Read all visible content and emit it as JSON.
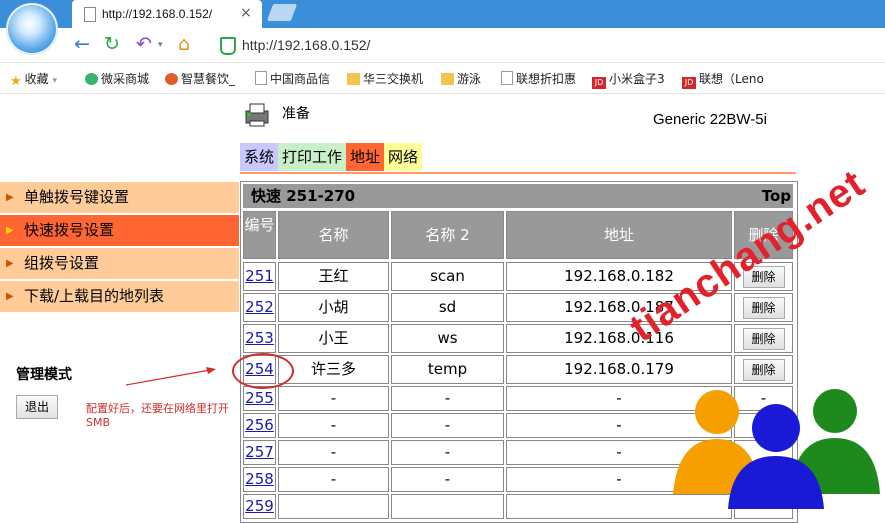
{
  "browser": {
    "tab_title": "http://192.168.0.152/",
    "address": "http://192.168.0.152/",
    "close_glyph": "×",
    "bookmarks": [
      {
        "label": "收藏",
        "icon": "star-icon"
      },
      {
        "label": "微采商城",
        "icon": "store-icon"
      },
      {
        "label": "智慧餐饮_",
        "icon": "food-icon"
      },
      {
        "label": "中国商品信",
        "icon": "page-icon"
      },
      {
        "label": "华三交换机",
        "icon": "folder-icon"
      },
      {
        "label": "游泳",
        "icon": "folder-icon"
      },
      {
        "label": "联想折扣惠",
        "icon": "page-icon"
      },
      {
        "label": "小米盒子3",
        "icon": "jd-icon"
      },
      {
        "label": "联想（Leno",
        "icon": "jd-icon"
      }
    ],
    "jd_badge": "JD"
  },
  "printer": {
    "status": "准备",
    "model": "Generic 22BW-5i"
  },
  "tabs": {
    "system": "系统",
    "print_job": "打印工作",
    "address": "地址",
    "network": "网络"
  },
  "sidebar": {
    "items": [
      {
        "label": "单触拨号键设置",
        "active": false
      },
      {
        "label": "快速拨号设置",
        "active": true
      },
      {
        "label": "组拨号设置",
        "active": false
      },
      {
        "label": "下载/上载目的地列表",
        "active": false
      }
    ],
    "mgmt_label": "管理模式",
    "logout": "退出"
  },
  "annotation": {
    "text": "配置好后，还要在网络里打开SMB"
  },
  "table": {
    "title": "快速 251-270",
    "top_link": "Top",
    "headers": {
      "num": "编号",
      "name": "名称",
      "name2": "名称 2",
      "address": "地址",
      "delete": "删除"
    },
    "rows": [
      {
        "num": "251",
        "name": "王红",
        "name2": "scan",
        "address": "192.168.0.182",
        "delete": "删除"
      },
      {
        "num": "252",
        "name": "小胡",
        "name2": "sd",
        "address": "192.168.0.187",
        "delete": "删除"
      },
      {
        "num": "253",
        "name": "小王",
        "name2": "ws",
        "address": "192.168.0.116",
        "delete": "删除"
      },
      {
        "num": "254",
        "name": "许三多",
        "name2": "temp",
        "address": "192.168.0.179",
        "delete": "删除"
      },
      {
        "num": "255",
        "name": "-",
        "name2": "-",
        "address": "-",
        "delete": "-"
      },
      {
        "num": "256",
        "name": "-",
        "name2": "-",
        "address": "-",
        "delete": ""
      },
      {
        "num": "257",
        "name": "-",
        "name2": "-",
        "address": "-",
        "delete": ""
      },
      {
        "num": "258",
        "name": "-",
        "name2": "-",
        "address": "-",
        "delete": ""
      },
      {
        "num": "259",
        "name": "",
        "name2": "",
        "address": "",
        "delete": ""
      }
    ]
  },
  "watermark": {
    "text": "tianchang.net"
  },
  "colors": {
    "address_tab": "#ff6633",
    "system_tab": "#c9c9ff",
    "job_tab": "#c9efc9",
    "network_tab": "#ffff99",
    "sidebar_item": "#ffcc99",
    "sidebar_active": "#ff6633",
    "annotation": "#d42b2b"
  }
}
